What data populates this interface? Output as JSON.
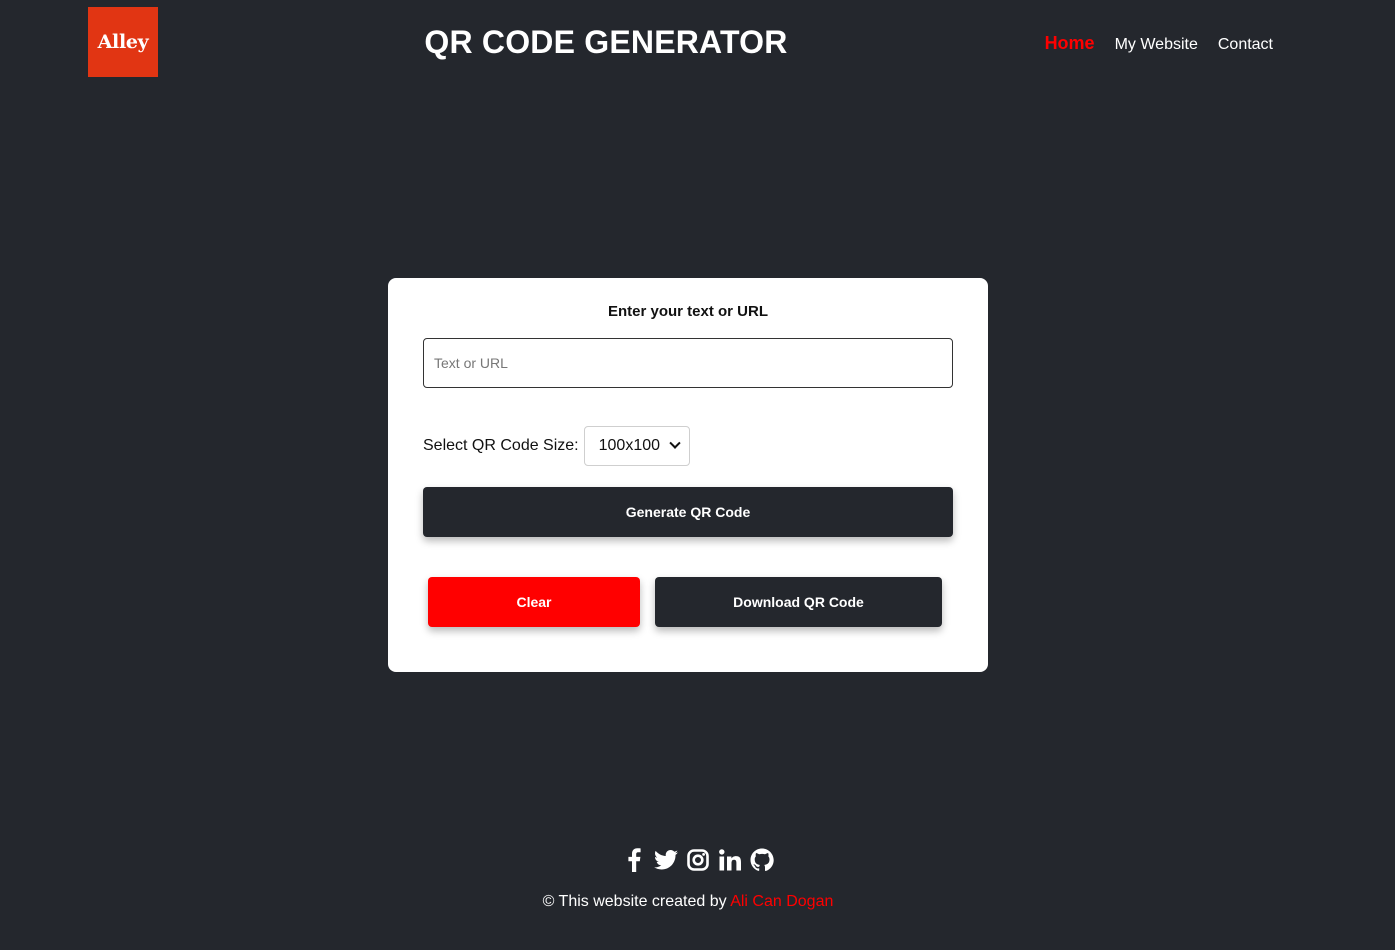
{
  "header": {
    "logo_text": "Alley",
    "title": "QR CODE GENERATOR",
    "nav": [
      {
        "label": "Home",
        "active": true
      },
      {
        "label": "My Website",
        "active": false
      },
      {
        "label": "Contact",
        "active": false
      }
    ]
  },
  "form": {
    "label": "Enter your text or URL",
    "input_placeholder": "Text or URL",
    "input_value": "",
    "size_label": "Select QR Code Size:",
    "size_selected": "100x100",
    "generate_label": "Generate QR Code",
    "clear_label": "Clear",
    "download_label": "Download QR Code"
  },
  "footer": {
    "icons": [
      "facebook-icon",
      "twitter-icon",
      "instagram-icon",
      "linkedin-icon",
      "github-icon"
    ],
    "credit_prefix": "© This website created by",
    "credit_author": "Ali Can Dogan"
  },
  "colors": {
    "background": "#24272d",
    "accent_red": "#ff0000",
    "logo_bg": "#e13513",
    "card_bg": "#ffffff"
  }
}
